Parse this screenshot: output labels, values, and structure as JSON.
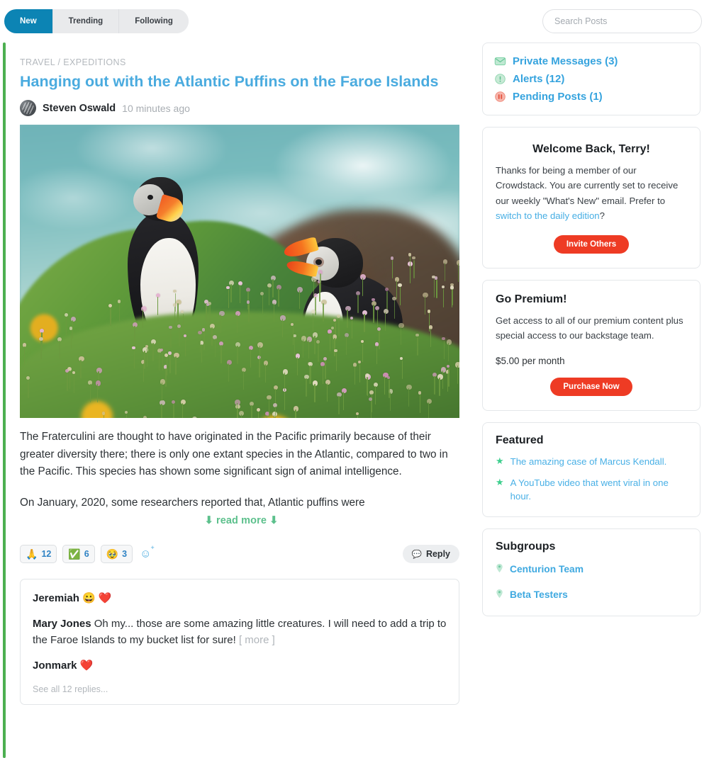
{
  "topbar": {
    "tabs": [
      {
        "label": "New",
        "active": true
      },
      {
        "label": "Trending",
        "active": false
      },
      {
        "label": "Following",
        "active": false
      }
    ],
    "search_placeholder": "Search Posts",
    "search_value": ""
  },
  "post": {
    "breadcrumb": "TRAVEL / EXPEDITIONS",
    "title": "Hanging out with the Atlantic Puffins on the Faroe Islands",
    "author": "Steven Oswald",
    "timestamp": "10 minutes ago",
    "image_alt": "Two Atlantic puffins standing on a grassy clifftop with pink sea thrift flowers, blurred turquoise ocean behind",
    "paragraph1": "The Fraterculini are thought to have originated in the Pacific primarily because of their greater diversity there; there is only one extant species in the Atlantic, compared to two in the Pacific. This species has shown some significant sign of animal intelligence.",
    "paragraph2": "On January, 2020, some researchers reported that, Atlantic puffins were",
    "read_more": "read more",
    "read_more_arrow": "⬇",
    "reactions": [
      {
        "emoji": "🙏",
        "count": "12",
        "name": "pray-reaction"
      },
      {
        "emoji": "✅",
        "count": "6",
        "name": "check-reaction"
      },
      {
        "emoji": "🥹",
        "count": "3",
        "name": "holding-back-tears-reaction"
      }
    ],
    "add_reaction_icon": "☺",
    "reply_label": "Reply",
    "reply_icon": "💬"
  },
  "comments": {
    "items": [
      {
        "author": "Jeremiah",
        "text": "",
        "emojis": "😀 ❤️",
        "more": ""
      },
      {
        "author": "Mary Jones",
        "text": " Oh my... those are some amazing little creatures. I will need to add a trip to the Faroe Islands to my bucket list for sure!",
        "emojis": "",
        "more": "[ more ]"
      },
      {
        "author": "Jonmark",
        "text": "",
        "emojis": "❤️",
        "more": ""
      }
    ],
    "see_all": "See all 12 replies..."
  },
  "sidebar": {
    "notifications": [
      {
        "label": "Private Messages (3)",
        "icon": "envelope-icon"
      },
      {
        "label": "Alerts (12)",
        "icon": "exclamation-circle-icon"
      },
      {
        "label": "Pending Posts (1)",
        "icon": "pause-circle-icon"
      }
    ],
    "welcome": {
      "title": "Welcome Back, Terry!",
      "body_before": "Thanks for being a member of our Crowdstack. You are currently set to receive our weekly \"What's New\" email. Prefer to ",
      "link": "switch to the daily edition",
      "body_after": "?",
      "button": "Invite Others"
    },
    "premium": {
      "title": "Go Premium!",
      "body": "Get access to all of our premium content plus special access to our backstage team.",
      "price": "$5.00 per month",
      "button": "Purchase Now"
    },
    "featured": {
      "title": "Featured",
      "items": [
        "The amazing case of Marcus Kendall.",
        "A YouTube video that went viral in one hour."
      ]
    },
    "subgroups": {
      "title": "Subgroups",
      "items": [
        "Centurion Team",
        "Beta Testers"
      ]
    }
  },
  "colors": {
    "tab_active": "#0c84b4",
    "title_blue": "#4aabdf",
    "accent_green": "#4caf50",
    "link_blue": "#35a3de",
    "button_red": "#ee3b24",
    "star_green": "#3ecf8e",
    "read_more_green": "#5cc08c"
  }
}
